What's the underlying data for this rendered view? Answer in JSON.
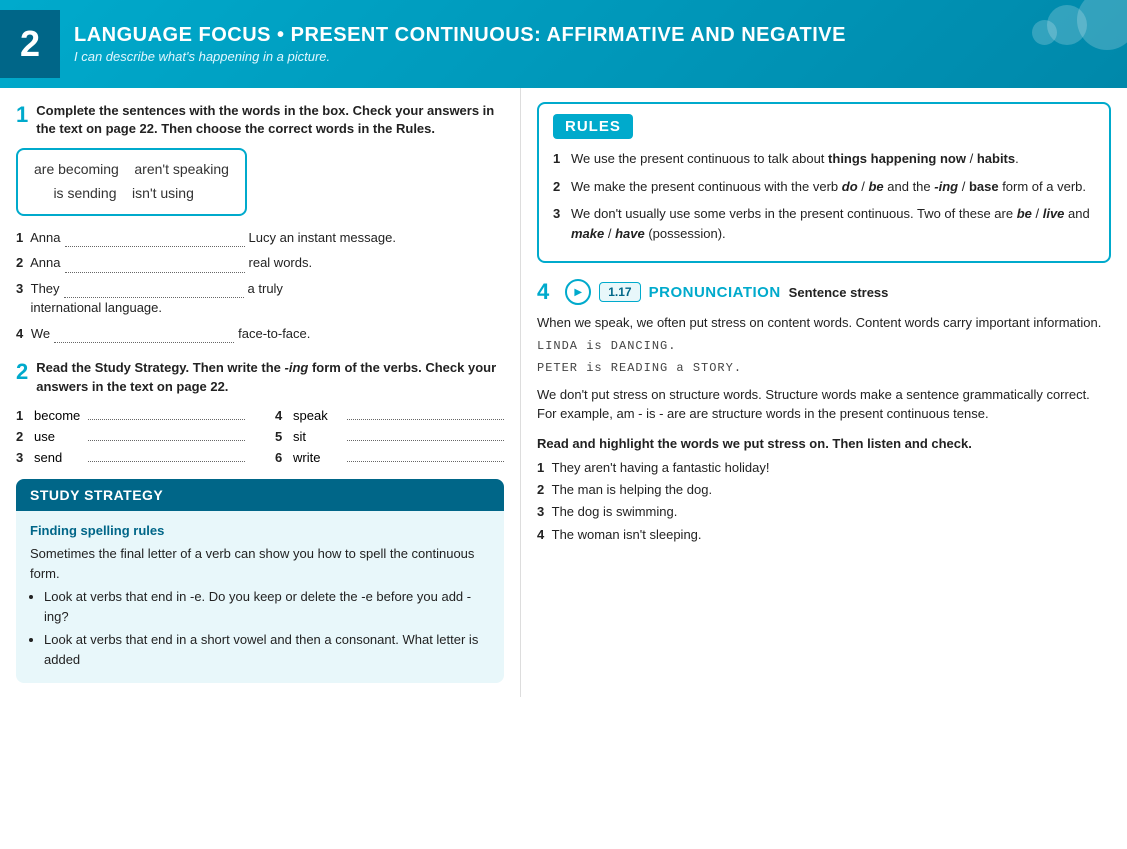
{
  "header": {
    "number": "2",
    "title": "LANGUAGE FOCUS • Present continuous: affirmative and negative",
    "subtitle": "I can describe what's happening in a picture."
  },
  "section1": {
    "number": "1",
    "instruction": "Complete the sentences with the words in the box. Check your answers in the text on page 22. Then choose the correct words in the Rules.",
    "wordbox": "are becoming    aren't speaking\n    is sending    isn't using",
    "sentences": [
      {
        "num": "1",
        "start": "Anna",
        "end": "Lucy an instant message."
      },
      {
        "num": "2",
        "start": "Anna",
        "end": "real words."
      },
      {
        "num": "3",
        "start": "They",
        "end": "a truly international language."
      },
      {
        "num": "4",
        "start": "We",
        "end": "face-to-face."
      }
    ]
  },
  "section2": {
    "number": "2",
    "instruction": "Read the Study Strategy. Then write the -ing form of the verbs. Check your answers in the text on page 22.",
    "verbs_left": [
      {
        "num": "1",
        "word": "become"
      },
      {
        "num": "2",
        "word": "use"
      },
      {
        "num": "3",
        "word": "send"
      }
    ],
    "verbs_right": [
      {
        "num": "4",
        "word": "speak"
      },
      {
        "num": "5",
        "word": "sit"
      },
      {
        "num": "6",
        "word": "write"
      }
    ]
  },
  "study_strategy": {
    "title": "STUDY STRATEGY",
    "subtitle": "Finding spelling rules",
    "body": "Sometimes the final letter of a verb can show you how to spell the continuous form.",
    "bullets": [
      "Look at verbs that end in -e. Do you keep or delete the -e before you add -ing?",
      "Look at verbs that end in a short vowel and then a consonant. What letter is added"
    ]
  },
  "rules": {
    "title": "RULES",
    "items": [
      {
        "num": "1",
        "text": "We use the present continuous to talk about ",
        "bold1": "things happening now",
        "mid1": " / ",
        "bold2": "habits",
        "rest": "."
      },
      {
        "num": "2",
        "text": "We make the present continuous with the verb ",
        "italic1": "do",
        "mid1": " / ",
        "italic2": "be",
        "rest": " and the ",
        "italic3": "-ing",
        "mid2": " / ",
        "bold1": "base",
        "rest2": " form of a verb."
      },
      {
        "num": "3",
        "text": "We don't usually use some verbs in the present continuous. Two of these are ",
        "italic1": "be",
        "mid1": " / ",
        "italic2": "live",
        "rest": " and ",
        "italic3": "make",
        "mid2": " / ",
        "italic4": "have",
        "rest2": " (possession)."
      }
    ]
  },
  "section4": {
    "number": "4",
    "audio_id": "1.17",
    "title": "PRONUNCIATION",
    "subtitle": "Sentence stress",
    "body1": "When we speak, we often put stress on content words. Content words carry important information.",
    "mono1": "LINDA is DANCING.",
    "mono2": "PETER is READING a STORY.",
    "body2": "We don't put stress on structure words. Structure words make a sentence grammatically correct. For example, am - is - are are structure words in the present continuous tense.",
    "read_instruction": "Read and highlight the words we put stress on. Then listen and check.",
    "examples": [
      {
        "num": "1",
        "text": "They aren't having a fantastic holiday!"
      },
      {
        "num": "2",
        "text": "The man is helping the dog."
      },
      {
        "num": "3",
        "text": "The dog is swimming."
      },
      {
        "num": "4",
        "text": "The woman isn't sleeping."
      }
    ]
  }
}
